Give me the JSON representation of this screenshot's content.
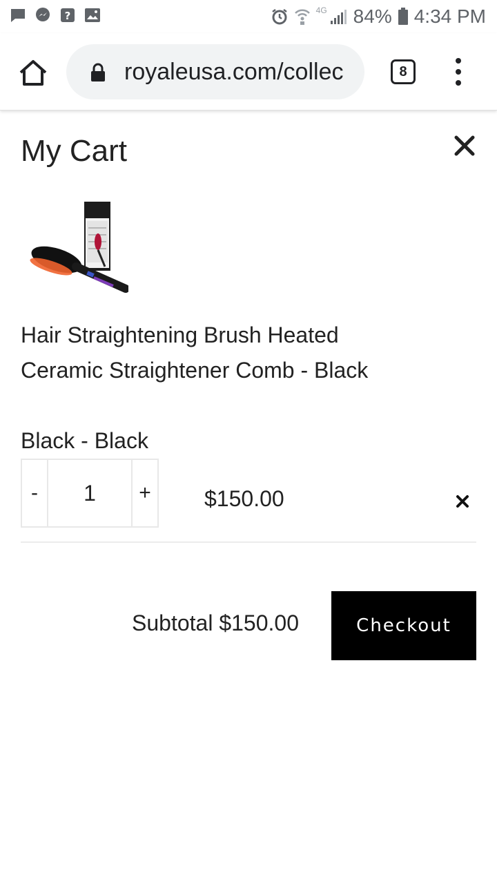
{
  "status_bar": {
    "battery": "84%",
    "time": "4:34 PM",
    "network": "4G"
  },
  "browser": {
    "url": "royaleusa.com/collec",
    "tab_count": "8"
  },
  "cart": {
    "title": "My Cart",
    "item": {
      "title": "Hair Straightening Brush Heated Ceramic Straightener Comb - Black",
      "variant": "Black - Black",
      "quantity": "1",
      "minus_label": "-",
      "plus_label": "+",
      "price": "$150.00"
    },
    "subtotal_label": "Subtotal $150.00",
    "checkout_label": "Checkout"
  },
  "colors": {
    "accent": "#000000",
    "text": "#222222",
    "url_bar_bg": "#f1f3f4"
  }
}
